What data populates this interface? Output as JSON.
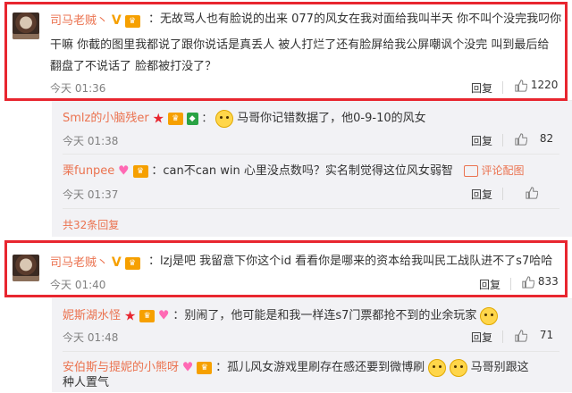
{
  "comments": [
    {
      "user": "司马老贼丶",
      "text_line1": "：无故骂人也有脸说的出来 077的风女在我对面给我叫半天 你不叫个没完我叼你",
      "text_line2": "干嘛 你截的图里我都说了跟你说话是真丢人  被人打烂了还有脸屏给我公屏嘲讽个没完  叫到最后给",
      "text_line3": "翻盘了不说话了   脸都被打没了？",
      "time": "今天 01:36",
      "reply_label": "回复",
      "likes": "1220"
    },
    {
      "user": "Smlz的小脑残er",
      "text": "马哥你记错数据了，他0-9-10的风女",
      "time": "今天 01:38",
      "reply_label": "回复",
      "likes": "82"
    },
    {
      "user": "栗funpee",
      "text": "：can不can win 心里没点数吗？实名制觉得这位风女弱智",
      "time": "今天 01:37",
      "reply_label": "回复",
      "report_label": "评论配图"
    },
    {
      "user": "司马老贼丶",
      "text": "：lzj是吧  我留意下你这个id 看看你是哪来的资本给我叫民工战队进不了s7哈哈",
      "time": "今天 01:40",
      "reply_label": "回复",
      "likes": "833"
    },
    {
      "user": "妮斯湖水怪",
      "text": "：别闹了，他可能是和我一样连s7门票都抢不到的业余玩家",
      "time": "今天 01:48",
      "reply_label": "回复",
      "likes": "71"
    },
    {
      "user": "安伯斯与提妮的小熊呀",
      "text_line1": "：孤儿风女游戏里刷存在感还要到微博刷",
      "text_line1_tail": "马哥别跟这",
      "text_line2": "种人置气"
    }
  ],
  "more_replies": "共32条回复",
  "colors": {
    "highlight_border": "#e8262f",
    "username": "#eb7350",
    "panel_bg": "#f2f2f5"
  },
  "icons": [
    "vip-v-icon",
    "vip-level-icon",
    "heart-icon",
    "star-icon",
    "thumb-up-icon",
    "emoji-icon",
    "image-icon"
  ]
}
